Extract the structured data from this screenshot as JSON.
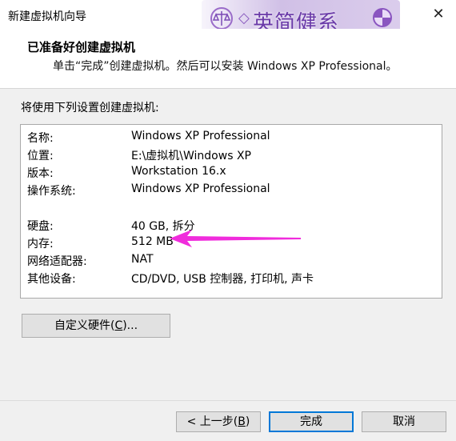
{
  "window": {
    "title": "新建虚拟机向导",
    "close_glyph": "✕"
  },
  "watermark": {
    "text": "英简健系",
    "diamond_glyph": "◇",
    "accent_color": "#6a3aa8"
  },
  "header": {
    "title": "已准备好创建虚拟机",
    "subtitle": "单击“完成”创建虚拟机。然后可以安装 Windows XP Professional。"
  },
  "intro": "将使用下列设置创建虚拟机:",
  "summary": {
    "rows": [
      {
        "label": "名称:",
        "value": "Windows XP Professional"
      },
      {
        "label": "位置:",
        "value": "E:\\虚拟机\\Windows XP"
      },
      {
        "label": "版本:",
        "value": "Workstation 16.x"
      },
      {
        "label": "操作系统:",
        "value": "Windows XP Professional"
      },
      {
        "label": "硬盘:",
        "value": "40 GB, 拆分"
      },
      {
        "label": "内存:",
        "value": "512 MB"
      },
      {
        "label": "网络适配器:",
        "value": "NAT"
      },
      {
        "label": "其他设备:",
        "value": "CD/DVD, USB 控制器, 打印机, 声卡"
      }
    ]
  },
  "customize": {
    "label_pre": "自定义硬件(",
    "accel": "C",
    "label_post": ")..."
  },
  "footer": {
    "back_pre": "< 上一步(",
    "back_accel": "B",
    "back_post": ")",
    "finish": "完成",
    "cancel": "取消"
  },
  "colors": {
    "arrow": "#f02cdc",
    "primary_border": "#0078d7"
  }
}
